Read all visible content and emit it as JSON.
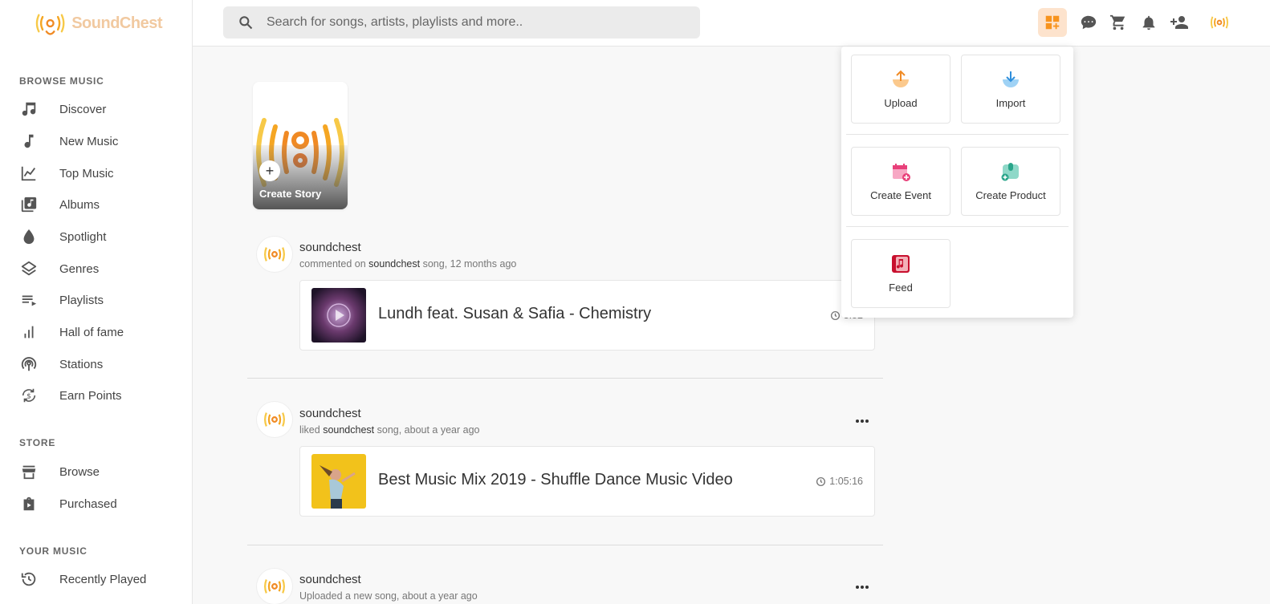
{
  "app": {
    "logo_text": "SoundChest"
  },
  "search": {
    "placeholder": "Search for songs, artists, playlists and more.."
  },
  "sidebar": {
    "browse_title": "BROWSE MUSIC",
    "browse_items": [
      {
        "label": "Discover",
        "icon": "music-note-icon"
      },
      {
        "label": "New Music",
        "icon": "single-note-icon"
      },
      {
        "label": "Top Music",
        "icon": "chart-icon"
      },
      {
        "label": "Albums",
        "icon": "album-icon"
      },
      {
        "label": "Spotlight",
        "icon": "drop-icon"
      },
      {
        "label": "Genres",
        "icon": "layers-icon"
      },
      {
        "label": "Playlists",
        "icon": "playlist-icon"
      },
      {
        "label": "Hall of fame",
        "icon": "bars-icon"
      },
      {
        "label": "Stations",
        "icon": "podcast-icon"
      },
      {
        "label": "Earn Points",
        "icon": "coin-icon"
      }
    ],
    "store_title": "STORE",
    "store_items": [
      {
        "label": "Browse",
        "icon": "store-icon"
      },
      {
        "label": "Purchased",
        "icon": "bag-icon"
      }
    ],
    "your_title": "YOUR MUSIC",
    "your_items": [
      {
        "label": "Recently Played",
        "icon": "history-icon"
      }
    ]
  },
  "story": {
    "label": "Create Story"
  },
  "feed": [
    {
      "user": "soundchest",
      "action": "commented on",
      "target": "soundchest",
      "suffix": "song, 12 months ago",
      "title": "Lundh feat. Susan & Safia - Chemistry",
      "duration": "3:52"
    },
    {
      "user": "soundchest",
      "action": "liked",
      "target": "soundchest",
      "suffix": "song, about a year ago",
      "title": "Best Music Mix 2019 - Shuffle Dance Music Video",
      "duration": "1:05:16"
    },
    {
      "user": "soundchest",
      "meta": "Uploaded a new song, about a year ago"
    }
  ],
  "dropdown": {
    "upload": "Upload",
    "import": "Import",
    "create_event": "Create Event",
    "create_product": "Create Product",
    "feed": "Feed"
  },
  "colors": {
    "accent": "#f7931e",
    "active_bg": "#fde3cd"
  }
}
